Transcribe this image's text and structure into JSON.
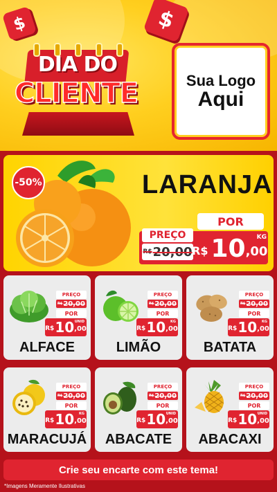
{
  "header": {
    "title_line1": "DIA DO",
    "title_line2": "CLIENTE",
    "logo_line1": "Sua Logo",
    "logo_line2": "Aqui"
  },
  "hero": {
    "discount": "-50%",
    "product": "LARANJA",
    "preco_label": "PREÇO",
    "old_currency": "R$",
    "old_price": "20,00",
    "por_label": "POR",
    "currency": "R$",
    "price_int": "10",
    "price_dec": ",00",
    "unit": "KG"
  },
  "products": [
    {
      "name": "ALFACE",
      "preco_label": "PREÇO",
      "old_currency": "R$",
      "old_price": "20,00",
      "por_label": "POR",
      "currency": "R$",
      "price_int": "10",
      "price_dec": ",00",
      "unit": "UNID"
    },
    {
      "name": "LIMÃO",
      "preco_label": "PREÇO",
      "old_currency": "R$",
      "old_price": "20,00",
      "por_label": "POR",
      "currency": "R$",
      "price_int": "10",
      "price_dec": ",00",
      "unit": "KG"
    },
    {
      "name": "BATATA",
      "preco_label": "PREÇO",
      "old_currency": "R$",
      "old_price": "20,00",
      "por_label": "POR",
      "currency": "R$",
      "price_int": "10",
      "price_dec": ",00",
      "unit": "KG"
    },
    {
      "name": "MARACUJÁ",
      "preco_label": "PREÇO",
      "old_currency": "R$",
      "old_price": "20,00",
      "por_label": "POR",
      "currency": "R$",
      "price_int": "10",
      "price_dec": ",00",
      "unit": "KG"
    },
    {
      "name": "ABACATE",
      "preco_label": "PREÇO",
      "old_currency": "R$",
      "old_price": "20,00",
      "por_label": "POR",
      "currency": "R$",
      "price_int": "10",
      "price_dec": ",00",
      "unit": "UNID"
    },
    {
      "name": "ABACAXI",
      "preco_label": "PREÇO",
      "old_currency": "R$",
      "old_price": "20,00",
      "por_label": "POR",
      "currency": "R$",
      "price_int": "10",
      "price_dec": ",00",
      "unit": "UNID"
    }
  ],
  "footer": {
    "cta": "Crie seu encarte com este tema!",
    "disclaimer": "*Imagens Meramente Ilustrativas"
  },
  "colors": {
    "brand_red": "#e02430",
    "brand_yellow": "#ffd400",
    "background_red": "#b5121b"
  },
  "icons": [
    "dollar-dice-icon",
    "orange-icon",
    "lettuce-icon",
    "lime-icon",
    "potato-icon",
    "passion-fruit-icon",
    "avocado-icon",
    "pineapple-icon"
  ]
}
